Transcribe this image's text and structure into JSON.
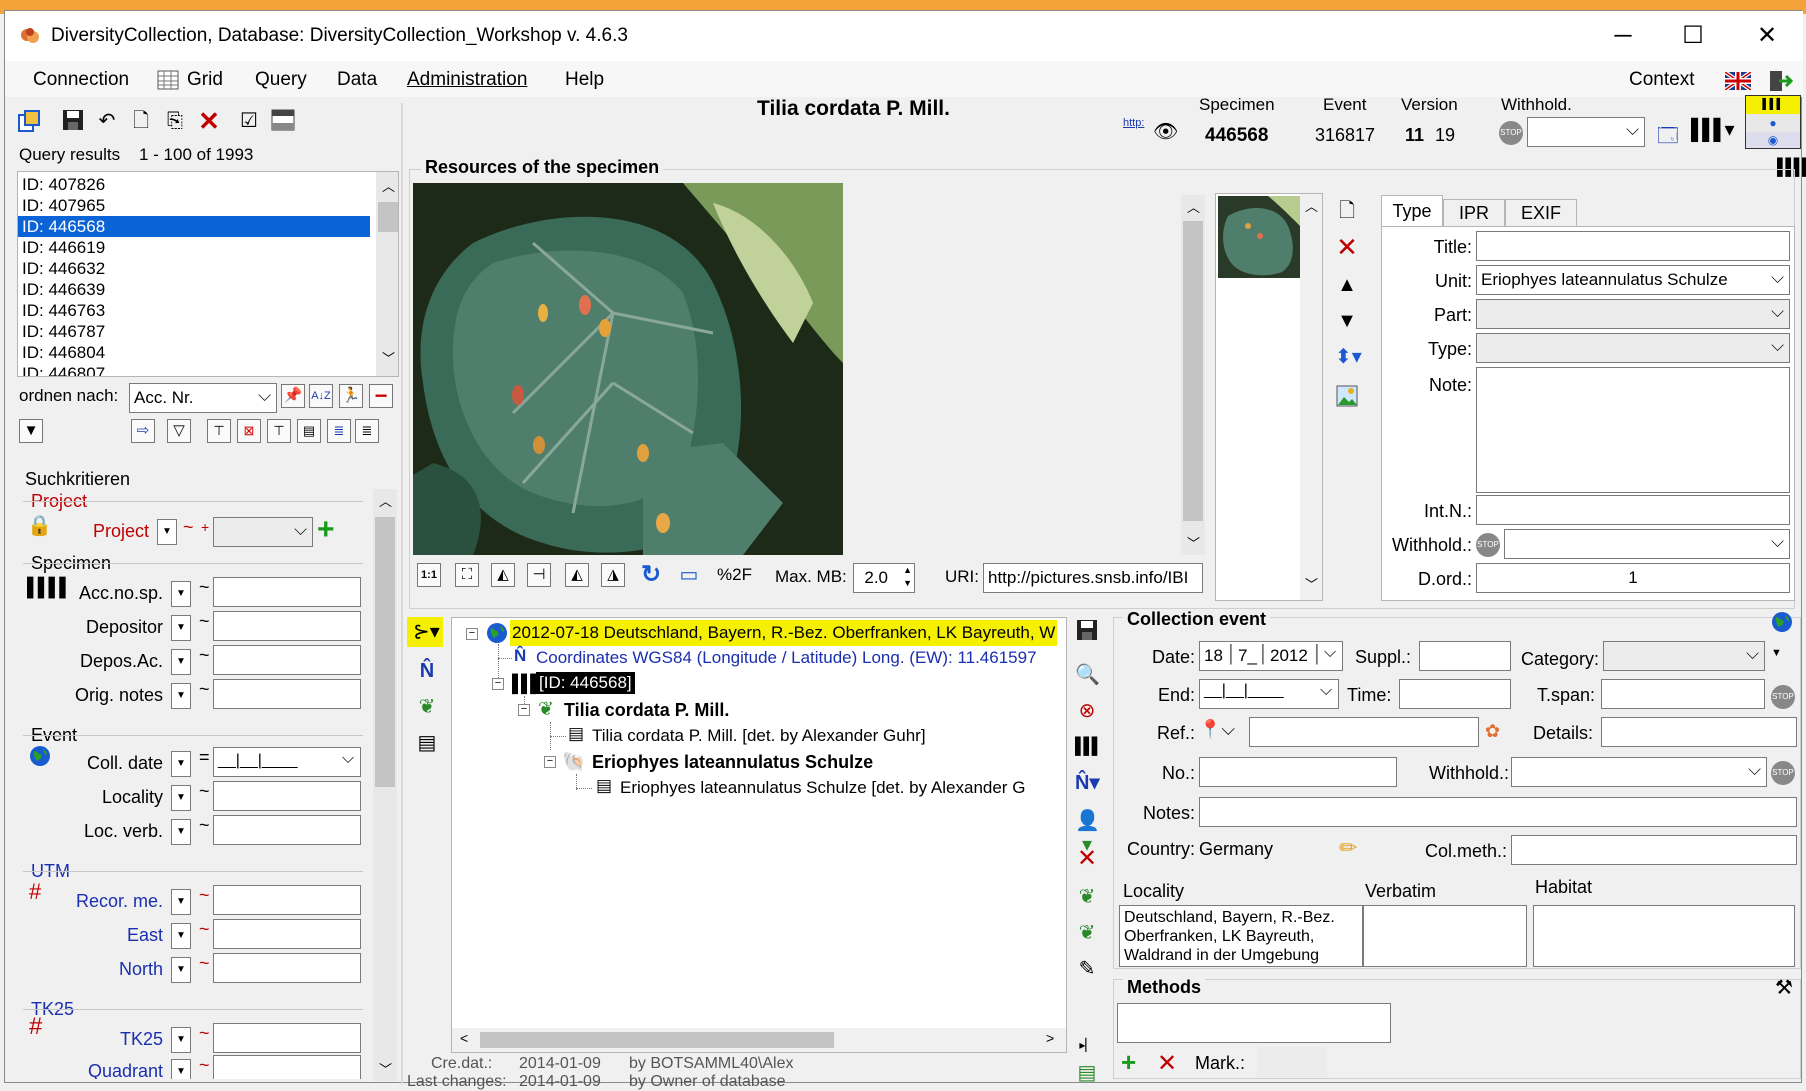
{
  "window": {
    "title": "DiversityCollection,  Database: DiversityCollection_Workshop   v. 4.6.3"
  },
  "menu": {
    "connection": "Connection",
    "grid": "Grid",
    "query": "Query",
    "data": "Data",
    "administration": "Administration",
    "help": "Help",
    "context": "Context"
  },
  "header": {
    "specimen_title": "Tilia cordata P. Mill.",
    "http": "http:",
    "specimen_label": "Specimen",
    "specimen_value": "446568",
    "event_label": "Event",
    "event_value": "316817",
    "version_label": "Version",
    "version_value": "11",
    "version_sub": "19",
    "withhold_label": "Withhold."
  },
  "query": {
    "results_label": "Query results",
    "results_range": "1 - 100 of 1993",
    "results": [
      "ID: 407826",
      "ID: 407965",
      "ID: 446568",
      "ID: 446619",
      "ID: 446632",
      "ID: 446639",
      "ID: 446763",
      "ID: 446787",
      "ID: 446804",
      "ID: 446807"
    ],
    "selected_index": 2,
    "order_label": "ordnen nach:",
    "order_value": "Acc. Nr."
  },
  "search": {
    "title": "Suchkritieren",
    "project_section": "Project",
    "project_label": "Project",
    "specimen_section": "Specimen",
    "acc_no": "Acc.no.sp.",
    "depositor": "Depositor",
    "depos_ac": "Depos.Ac.",
    "orig_notes": "Orig. notes",
    "event_section": "Event",
    "coll_date": "Coll. date",
    "locality": "Locality",
    "loc_verb": "Loc. verb.",
    "utm_section": "UTM",
    "recor_me": "Recor. me.",
    "east": "East",
    "north": "North",
    "tk25_section": "TK25",
    "tk25": "TK25",
    "quadrant": "Quadrant"
  },
  "resources": {
    "title": "Resources of the specimen",
    "zoom_label": "%2F",
    "maxmb_label": "Max. MB:",
    "maxmb_value": "2.0",
    "uri_label": "URI:",
    "uri_value": "http://pictures.snsb.info/IBI",
    "tabs": [
      "Type",
      "IPR",
      "EXIF"
    ],
    "title_label": "Title:",
    "unit_label": "Unit:",
    "unit_value": "Eriophyes  lateannulatus Schulze",
    "part_label": "Part:",
    "type_label": "Type:",
    "note_label": "Note:",
    "intn_label": "Int.N.:",
    "withhold_label": "Withhold.:",
    "dord_label": "D.ord.:",
    "dord_value": "1"
  },
  "tree": {
    "event": "2012-07-18 Deutschland, Bayern, R.-Bez. Oberfranken, LK Bayreuth, W",
    "coords": "Coordinates WGS84 (Longitude / Latitude) Long. (EW): 11.461597",
    "specimen": "[ID: 446568]",
    "unit1": "Tilia cordata P. Mill.",
    "ident1": "Tilia cordata P. Mill.   [det. by Alexander Guhr]",
    "unit2": "Eriophyes  lateannulatus Schulze",
    "ident2": "Eriophyes  lateannulatus Schulze   [det. by Alexander G"
  },
  "footer": {
    "cre_label": "Cre.dat.:",
    "cre_date": "2014-01-09",
    "cre_by": "by  BOTSAMML40\\Alex",
    "last_label": "Last changes:",
    "last_date": "2014-01-09",
    "last_by": "by  Owner of database"
  },
  "event": {
    "title": "Collection event",
    "date_label": "Date:",
    "date_day": "18",
    "date_month": "7_",
    "date_year": "2012",
    "suppl_label": "Suppl.:",
    "category_label": "Category:",
    "end_label": "End:",
    "time_label": "Time:",
    "tspan_label": "T.span:",
    "ref_label": "Ref.:",
    "details_label": "Details:",
    "no_label": "No.:",
    "withhold_label": "Withhold.:",
    "notes_label": "Notes:",
    "country_label": "Country:",
    "country_value": "Germany",
    "colmeth_label": "Col.meth.:",
    "locality_label": "Locality",
    "verbatim_label": "Verbatim",
    "habitat_label": "Habitat",
    "locality_text": "Deutschland, Bayern, R.-Bez. Oberfranken, LK Bayreuth, Waldrand in der Umgebung",
    "methods_title": "Methods",
    "mark_label": "Mark.:"
  }
}
